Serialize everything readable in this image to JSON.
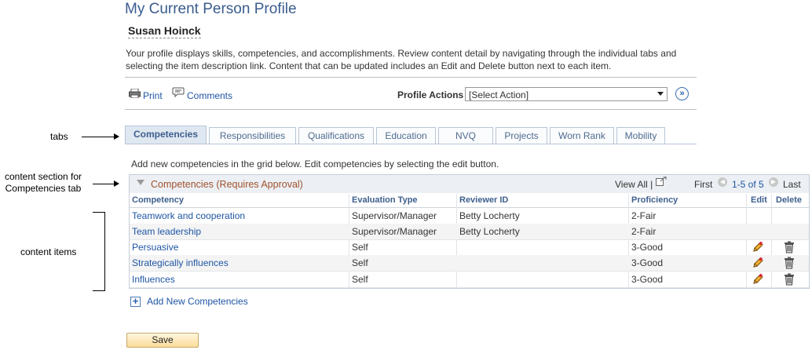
{
  "page": {
    "title": "My Current Person Profile",
    "person_name": "Susan Hoinck",
    "description": "Your profile displays skills, competencies, and accomplishments. Review content detail by navigating through the individual tabs and selecting the item description link. Content that can be updated includes an Edit and Delete button next to each item."
  },
  "toolbar": {
    "print_label": "Print",
    "comments_label": "Comments",
    "profile_actions_label": "Profile Actions",
    "profile_actions_value": "[Select Action]"
  },
  "annotations": {
    "tabs": "tabs",
    "content_section_line1": "content section for",
    "content_section_line2": "Competencies tab",
    "content_items": "content items"
  },
  "tabs": [
    {
      "label": "Competencies",
      "active": true
    },
    {
      "label": "Responsibilities"
    },
    {
      "label": "Qualifications"
    },
    {
      "label": "Education"
    },
    {
      "label": "NVQ"
    },
    {
      "label": "Projects"
    },
    {
      "label": "Worn Rank"
    },
    {
      "label": "Mobility"
    }
  ],
  "grid": {
    "intro": "Add new competencies in the grid below. Edit competencies by selecting the edit button.",
    "title": "Competencies (Requires Approval)",
    "view_all": "View All |",
    "first": "First",
    "range": "1-5 of 5",
    "last": "Last",
    "columns": [
      "Competency",
      "Evaluation Type",
      "Reviewer ID",
      "Proficiency",
      "Edit",
      "Delete"
    ],
    "rows": [
      {
        "competency": "Teamwork and cooperation",
        "evaluation": "Supervisor/Manager",
        "reviewer": "Betty Locherty",
        "proficiency": "2-Fair",
        "editable": false
      },
      {
        "competency": "Team leadership",
        "evaluation": "Supervisor/Manager",
        "reviewer": "Betty Locherty",
        "proficiency": "2-Fair",
        "editable": false
      },
      {
        "competency": "Persuasive",
        "evaluation": "Self",
        "reviewer": "",
        "proficiency": "3-Good",
        "editable": true
      },
      {
        "competency": "Strategically influences",
        "evaluation": "Self",
        "reviewer": "",
        "proficiency": "3-Good",
        "editable": true
      },
      {
        "competency": "Influences",
        "evaluation": "Self",
        "reviewer": "",
        "proficiency": "3-Good",
        "editable": true
      }
    ],
    "add_label": "Add New Competencies"
  },
  "buttons": {
    "save": "Save"
  },
  "colors": {
    "title": "#3a5c8e",
    "link": "#1f56a4",
    "grid_title": "#a0522d",
    "save_bg": "#fbdc9a"
  }
}
